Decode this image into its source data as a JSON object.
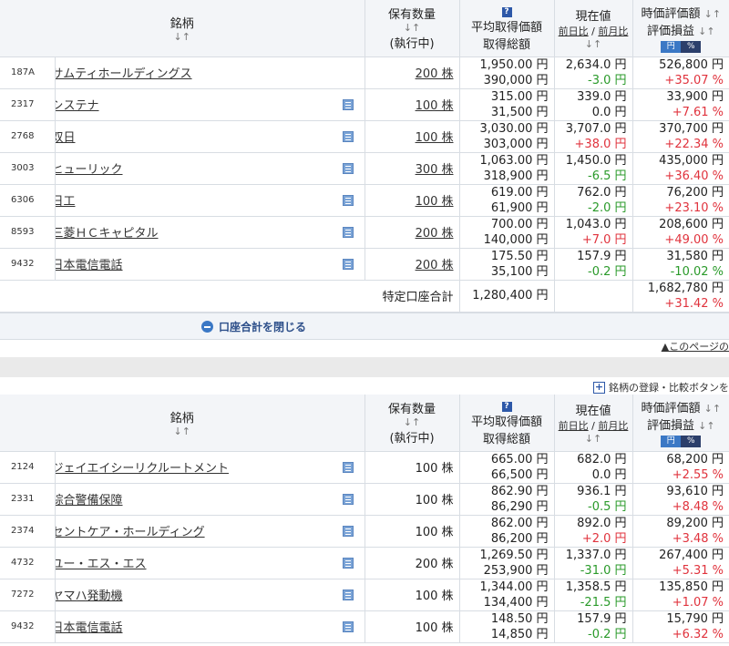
{
  "header": {
    "col_name": "銘柄",
    "col_qty": "保有数量",
    "col_qty_sub": "(執行中)",
    "col_avg": "平均取得価額",
    "col_avg_sub": "取得総額",
    "col_price": "現在値",
    "col_price_sub_a": "前日比",
    "col_price_sub_b": "前月比",
    "col_value": "時価評価額",
    "col_value_sub": "評価損益",
    "sort_glyph": "↓↑",
    "help_glyph": "?",
    "unit_yen": "円",
    "unit_pct": "%"
  },
  "table1": {
    "rows": [
      {
        "code": "187A",
        "name": "サムティホールディングス",
        "qty": "200 株",
        "avg": "1,950.00 円",
        "total": "390,000 円",
        "price": "2,634.0 円",
        "change": "-3.0 円",
        "change_class": "neg",
        "value": "526,800 円",
        "pl": "+35.07 %",
        "pl_class": "pos",
        "ledger": false
      },
      {
        "code": "2317",
        "name": "システナ",
        "qty": "100 株",
        "avg": "315.00 円",
        "total": "31,500 円",
        "price": "339.0 円",
        "change": "0.0 円",
        "change_class": "zero",
        "value": "33,900 円",
        "pl": "+7.61 %",
        "pl_class": "pos",
        "ledger": true
      },
      {
        "code": "2768",
        "name": "双日",
        "qty": "100 株",
        "avg": "3,030.00 円",
        "total": "303,000 円",
        "price": "3,707.0 円",
        "change": "+38.0 円",
        "change_class": "pos",
        "value": "370,700 円",
        "pl": "+22.34 %",
        "pl_class": "pos",
        "ledger": true
      },
      {
        "code": "3003",
        "name": "ヒューリック",
        "qty": "300 株",
        "avg": "1,063.00 円",
        "total": "318,900 円",
        "price": "1,450.0 円",
        "change": "-6.5 円",
        "change_class": "neg",
        "value": "435,000 円",
        "pl": "+36.40 %",
        "pl_class": "pos",
        "ledger": true
      },
      {
        "code": "6306",
        "name": "日工",
        "qty": "100 株",
        "avg": "619.00 円",
        "total": "61,900 円",
        "price": "762.0 円",
        "change": "-2.0 円",
        "change_class": "neg",
        "value": "76,200 円",
        "pl": "+23.10 %",
        "pl_class": "pos",
        "ledger": true
      },
      {
        "code": "8593",
        "name": "三菱ＨＣキャピタル",
        "qty": "200 株",
        "avg": "700.00 円",
        "total": "140,000 円",
        "price": "1,043.0 円",
        "change": "+7.0 円",
        "change_class": "pos",
        "value": "208,600 円",
        "pl": "+49.00 %",
        "pl_class": "pos",
        "ledger": true
      },
      {
        "code": "9432",
        "name": "日本電信電話",
        "qty": "200 株",
        "avg": "175.50 円",
        "total": "35,100 円",
        "price": "157.9 円",
        "change": "-0.2 円",
        "change_class": "neg",
        "value": "31,580 円",
        "pl": "-10.02 %",
        "pl_class": "neg",
        "ledger": true
      }
    ],
    "summary": {
      "label": "特定口座合計",
      "total": "1,280,400 円",
      "value": "1,682,780 円",
      "pl": "+31.42 %"
    }
  },
  "close_label": "口座合計を閉じる",
  "page_top": "▲このページの",
  "register_label": "銘柄の登録・比較ボタンを",
  "table2": {
    "rows": [
      {
        "code": "2124",
        "name": "ジェイエイシーリクルートメント",
        "qty": "100 株",
        "avg": "665.00 円",
        "total": "66,500 円",
        "price": "682.0 円",
        "change": "0.0 円",
        "change_class": "zero",
        "value": "68,200 円",
        "pl": "+2.55 %",
        "pl_class": "pos"
      },
      {
        "code": "2331",
        "name": "綜合警備保障",
        "qty": "100 株",
        "avg": "862.90 円",
        "total": "86,290 円",
        "price": "936.1 円",
        "change": "-0.5 円",
        "change_class": "neg",
        "value": "93,610 円",
        "pl": "+8.48 %",
        "pl_class": "pos"
      },
      {
        "code": "2374",
        "name": "セントケア・ホールディング",
        "qty": "100 株",
        "avg": "862.00 円",
        "total": "86,200 円",
        "price": "892.0 円",
        "change": "+2.0 円",
        "change_class": "pos",
        "value": "89,200 円",
        "pl": "+3.48 %",
        "pl_class": "pos"
      },
      {
        "code": "4732",
        "name": "ユー・エス・エス",
        "qty": "200 株",
        "avg": "1,269.50 円",
        "total": "253,900 円",
        "price": "1,337.0 円",
        "change": "-31.0 円",
        "change_class": "neg",
        "value": "267,400 円",
        "pl": "+5.31 %",
        "pl_class": "pos"
      },
      {
        "code": "7272",
        "name": "ヤマハ発動機",
        "qty": "100 株",
        "avg": "1,344.00 円",
        "total": "134,400 円",
        "price": "1,358.5 円",
        "change": "-21.5 円",
        "change_class": "neg",
        "value": "135,850 円",
        "pl": "+1.07 %",
        "pl_class": "pos"
      },
      {
        "code": "9432",
        "name": "日本電信電話",
        "qty": "100 株",
        "avg": "148.50 円",
        "total": "14,850 円",
        "price": "157.9 円",
        "change": "-0.2 円",
        "change_class": "neg",
        "value": "15,790 円",
        "pl": "+6.32 %",
        "pl_class": "pos"
      }
    ]
  }
}
